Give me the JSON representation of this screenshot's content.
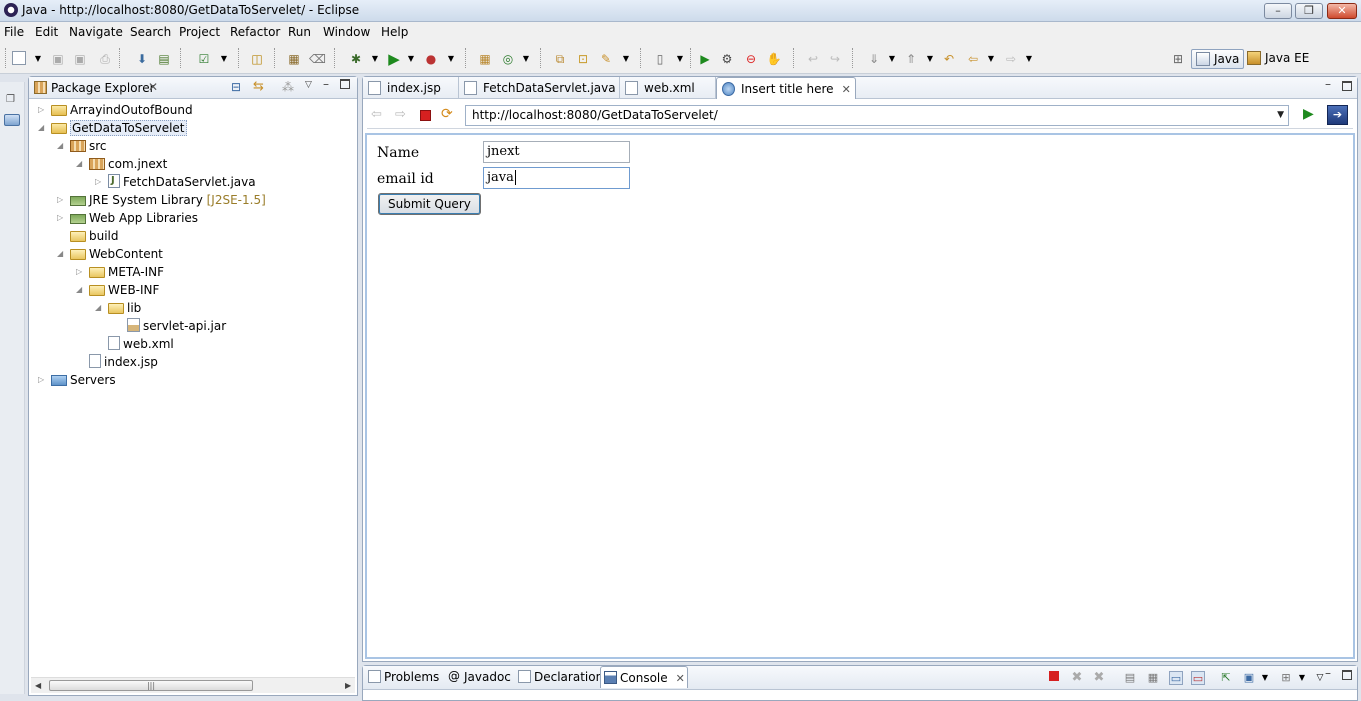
{
  "window": {
    "title": "Java - http://localhost:8080/GetDataToServelet/ - Eclipse",
    "minimize": "–",
    "maximize": "❐",
    "close": "✕"
  },
  "menu": [
    "File",
    "Edit",
    "Navigate",
    "Search",
    "Project",
    "Refactor",
    "Run",
    "Window",
    "Help"
  ],
  "toolbar": {
    "icons": [
      "new-icon",
      "save-icon",
      "save-all-icon",
      "print-icon",
      "build-icon",
      "terminal-icon",
      "task-icon",
      "open-type-icon",
      "new-package-icon",
      "new-class-icon",
      "debug-icon",
      "run-icon",
      "external-tools-icon",
      "new-server-icon",
      "web-service-icon",
      "open-folder-icon",
      "search-icon",
      "annotation-icon",
      "resume-icon",
      "suspend-icon",
      "terminate-icon",
      "step-icon",
      "back-icon",
      "forward-icon"
    ],
    "perspectives": [
      {
        "label": "Java",
        "active": true
      },
      {
        "label": "Java EE",
        "active": false
      }
    ]
  },
  "package_explorer": {
    "title": "Package Explorer",
    "tree": [
      {
        "label": "ArrayindOutofBound",
        "icon": "project"
      },
      {
        "label": "GetDataToServelet",
        "icon": "project",
        "selected": true
      },
      {
        "label": "src",
        "icon": "folder"
      },
      {
        "label": "com.jnext",
        "icon": "package"
      },
      {
        "label": "FetchDataServlet.java",
        "icon": "java"
      },
      {
        "label": "JRE System Library",
        "decor": "[J2SE-1.5]",
        "icon": "library"
      },
      {
        "label": "Web App Libraries",
        "icon": "library"
      },
      {
        "label": "build",
        "icon": "folder"
      },
      {
        "label": "WebContent",
        "icon": "folder"
      },
      {
        "label": "META-INF",
        "icon": "folder"
      },
      {
        "label": "WEB-INF",
        "icon": "folder"
      },
      {
        "label": "lib",
        "icon": "folder"
      },
      {
        "label": "servlet-api.jar",
        "icon": "jar"
      },
      {
        "label": "web.xml",
        "icon": "file"
      },
      {
        "label": "index.jsp",
        "icon": "file"
      },
      {
        "label": "Servers",
        "icon": "server"
      }
    ],
    "scroll_glyph": "|||"
  },
  "editor": {
    "tabs": [
      {
        "label": "index.jsp",
        "active": false
      },
      {
        "label": "FetchDataServlet.java",
        "active": false
      },
      {
        "label": "web.xml",
        "active": false
      },
      {
        "label": "Insert title here",
        "active": true
      }
    ],
    "url": "http://localhost:8080/GetDataToServelet/",
    "form": {
      "name_label": "Name",
      "name_value": "jnext",
      "email_label": "email id",
      "email_value": "java",
      "submit_label": "Submit Query"
    }
  },
  "console": {
    "tabs": [
      {
        "label": "Problems",
        "active": false
      },
      {
        "label": "Javadoc",
        "active": false
      },
      {
        "label": "Declaration",
        "active": false
      },
      {
        "label": "Console",
        "active": true
      }
    ]
  }
}
